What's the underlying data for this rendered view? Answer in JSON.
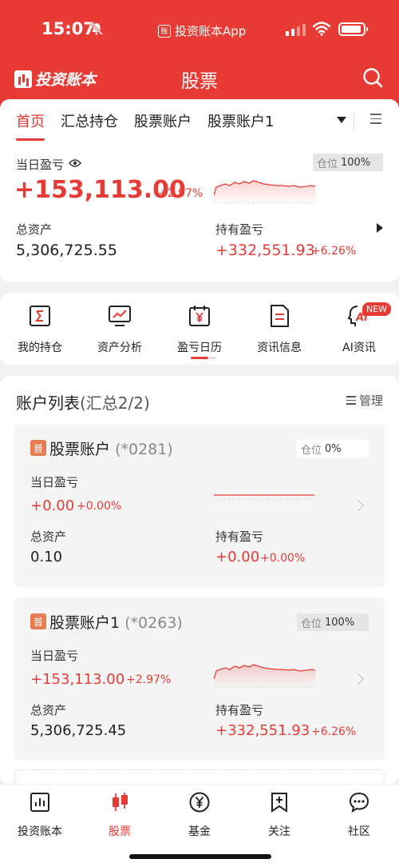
{
  "status_bar": {
    "time": "15:07",
    "app_label": "投资账本App",
    "app_mini": "账"
  },
  "header": {
    "logo_text": "投资账本",
    "title": "股票"
  },
  "tabs": [
    {
      "label": "首页",
      "active": true
    },
    {
      "label": "汇总持仓",
      "active": false
    },
    {
      "label": "股票账户",
      "active": false
    },
    {
      "label": "股票账户1",
      "active": false
    }
  ],
  "summary": {
    "daily_pnl_label": "当日盈亏",
    "position_label": "仓位",
    "position_value": "100%",
    "position_fraction": 1.0,
    "daily_pnl": "+153,113.00",
    "daily_pnl_pct": "+2.97%",
    "total_assets_label": "总资产",
    "total_assets": "5,306,725.55",
    "holding_pnl_label": "持有盈亏",
    "holding_pnl": "+332,551.93",
    "holding_pnl_pct": "+6.26%"
  },
  "actions": [
    {
      "label": "我的持仓",
      "icon": "sigma-icon"
    },
    {
      "label": "资产分析",
      "icon": "chart-monitor-icon"
    },
    {
      "label": "盈亏日历",
      "icon": "calendar-yen-icon"
    },
    {
      "label": "资讯信息",
      "icon": "document-icon"
    },
    {
      "label": "AI资讯",
      "icon": "ai-head-icon",
      "badge": "NEW"
    }
  ],
  "account_list": {
    "title": "账户列表",
    "count": "(汇总2/2)",
    "manage_label": "管理",
    "accounts": [
      {
        "tag": "普",
        "name": "股票账户",
        "number": "(*0281)",
        "position_label": "仓位",
        "position_value": "0%",
        "position_fraction": 0,
        "daily_pnl_label": "当日盈亏",
        "daily_pnl": "+0.00",
        "daily_pnl_pct": "+0.00%",
        "total_assets_label": "总资产",
        "total_assets": "0.10",
        "holding_pnl_label": "持有盈亏",
        "holding_pnl": "+0.00",
        "holding_pnl_pct": "+0.00%"
      },
      {
        "tag": "普",
        "name": "股票账户1",
        "number": "(*0263)",
        "position_label": "仓位",
        "position_value": "100%",
        "position_fraction": 1.0,
        "daily_pnl_label": "当日盈亏",
        "daily_pnl": "+153,113.00",
        "daily_pnl_pct": "+2.97%",
        "total_assets_label": "总资产",
        "total_assets": "5,306,725.45",
        "holding_pnl_label": "持有盈亏",
        "holding_pnl": "+332,551.93",
        "holding_pnl_pct": "+6.26%"
      }
    ]
  },
  "bottom_nav": [
    {
      "label": "投资账本",
      "icon": "ledger-chart-icon",
      "active": false
    },
    {
      "label": "股票",
      "icon": "candlestick-icon",
      "active": true
    },
    {
      "label": "基金",
      "icon": "yen-circle-icon",
      "active": false
    },
    {
      "label": "关注",
      "icon": "bookmark-plus-icon",
      "active": false
    },
    {
      "label": "社区",
      "icon": "chat-bubble-icon",
      "active": false
    }
  ],
  "colors": {
    "brand_red": "#e93b35",
    "background": "#f2f2f2",
    "tag_orange": "#e87b52"
  }
}
